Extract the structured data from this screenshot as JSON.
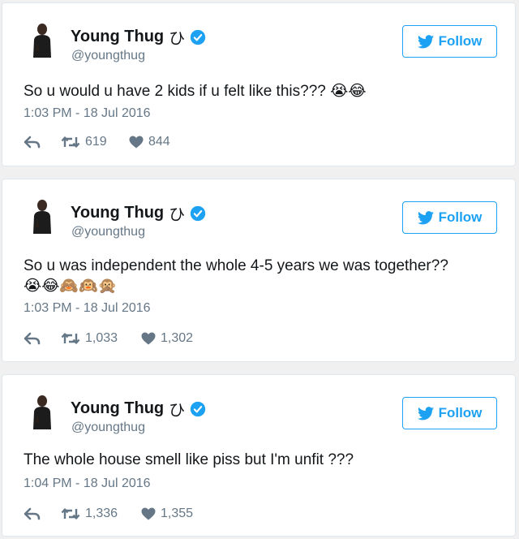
{
  "tweets": [
    {
      "name": "Young Thug",
      "name_glyph": "ひ",
      "handle": "@youngthug",
      "follow_label": "Follow",
      "text": "So u would u have 2 kids if u felt like this???",
      "emoji": "😭😂",
      "timestamp": "1:03 PM - 18 Jul 2016",
      "retweets": "619",
      "likes": "844"
    },
    {
      "name": "Young Thug",
      "name_glyph": "ひ",
      "handle": "@youngthug",
      "follow_label": "Follow",
      "text": "So u was independent the whole 4-5 years we was together??",
      "emoji": "😭😂🙈🙉🙊",
      "timestamp": "1:03 PM - 18 Jul 2016",
      "retweets": "1,033",
      "likes": "1,302"
    },
    {
      "name": "Young Thug",
      "name_glyph": "ひ",
      "handle": "@youngthug",
      "follow_label": "Follow",
      "text": "The whole house smell like piss but I'm unfit ???",
      "emoji": "",
      "timestamp": "1:04 PM - 18 Jul 2016",
      "retweets": "1,336",
      "likes": "1,355"
    }
  ],
  "icons": {
    "verified": "verified-badge-icon",
    "bird": "twitter-bird-icon",
    "reply": "reply-icon",
    "retweet": "retweet-icon",
    "like": "heart-icon"
  },
  "colors": {
    "brand": "#1da1f2",
    "muted": "#657786",
    "text": "#14171a",
    "border": "#e1e8ed"
  }
}
